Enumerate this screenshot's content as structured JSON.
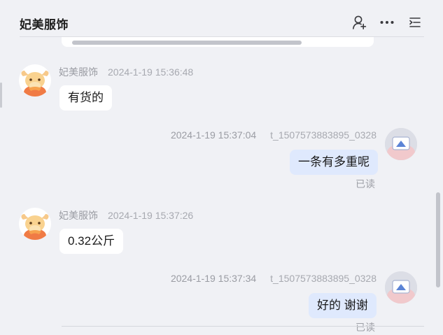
{
  "header": {
    "title": "妃美服饰",
    "icons": [
      "user-add-icon",
      "more-icon",
      "menu-list-icon"
    ]
  },
  "messages": [
    {
      "side": "left",
      "sender": "妃美服饰",
      "time": "2024-1-19 15:36:48",
      "text": "有货的"
    },
    {
      "side": "right",
      "sender": "t_1507573883895_0328",
      "time": "2024-1-19 15:37:04",
      "text": "一条有多重呢",
      "status": "已读"
    },
    {
      "side": "left",
      "sender": "妃美服饰",
      "time": "2024-1-19 15:37:26",
      "text": "0.32公斤"
    },
    {
      "side": "right",
      "sender": "t_1507573883895_0328",
      "time": "2024-1-19 15:37:34",
      "text": "好的 谢谢",
      "status": "已读"
    }
  ],
  "colors": {
    "background": "#f0f1f5",
    "bubble_left": "#ffffff",
    "bubble_right": "#dfe9fd",
    "meta_text": "#a7a9b0"
  }
}
